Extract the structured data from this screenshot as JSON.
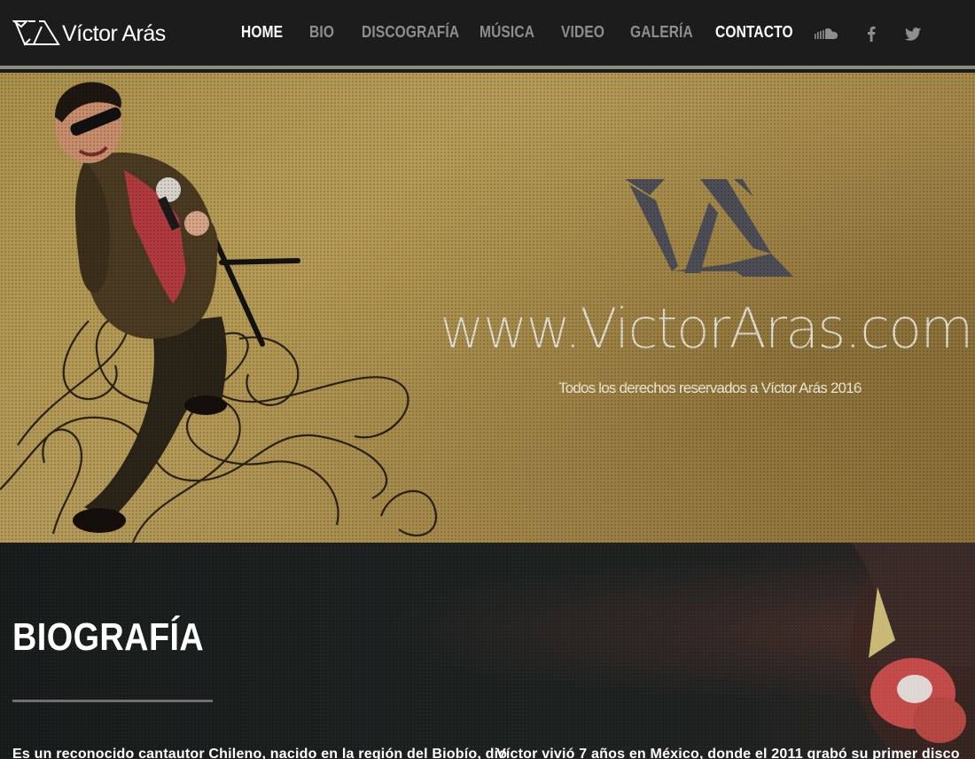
{
  "brand": {
    "name": "Víctor Arás",
    "logo_icon": "va-logo-mark"
  },
  "nav": {
    "items": [
      {
        "label": "HOME",
        "active": true
      },
      {
        "label": "BIO",
        "active": false
      },
      {
        "label": "DISCOGRAFÍA",
        "active": false
      },
      {
        "label": "MÚSICA",
        "active": false
      },
      {
        "label": "VIDEO",
        "active": false
      },
      {
        "label": "GALERÍA",
        "active": false
      },
      {
        "label": "CONTACTO",
        "active": false,
        "highlight": true
      }
    ],
    "social": [
      {
        "icon": "soundcloud-icon"
      },
      {
        "icon": "facebook-icon"
      },
      {
        "icon": "twitter-icon"
      }
    ]
  },
  "hero": {
    "url_text": "www.VictorAras.com",
    "copyright": "Todos los derechos reservados a Víctor Arás 2016"
  },
  "bio": {
    "title": "BIOGRAFÍA",
    "col1": "Es un reconocido cantautor Chileno, nacido en la región del Biobío, dio",
    "col2": "Víctor vivió 7 años en México, donde el 2011 grabó su primer disco"
  },
  "colors": {
    "nav_bg": "#1c1c1c",
    "nav_text": "#8e8e8e",
    "nav_active": "#ffffff",
    "hero_gold": "#a88f4b",
    "bio_bg": "#1b201f"
  }
}
